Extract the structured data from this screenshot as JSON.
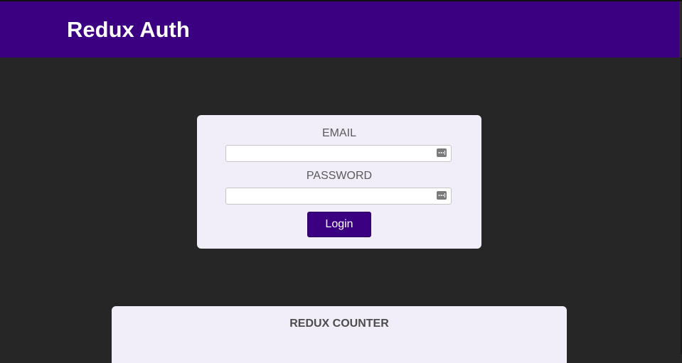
{
  "header": {
    "title": "Redux Auth",
    "background_color": "#3b0082"
  },
  "auth": {
    "email": {
      "label": "EMAIL",
      "value": "",
      "icon": "password-manager-key-icon"
    },
    "password": {
      "label": "PASSWORD",
      "value": "",
      "icon": "password-manager-key-icon"
    },
    "login_label": "Login",
    "card_color": "#f1eef9"
  },
  "counter": {
    "title": "REDUX COUNTER"
  },
  "colors": {
    "page_background": "#262626",
    "accent": "#3b0082",
    "label_text": "#5a5a5a"
  }
}
